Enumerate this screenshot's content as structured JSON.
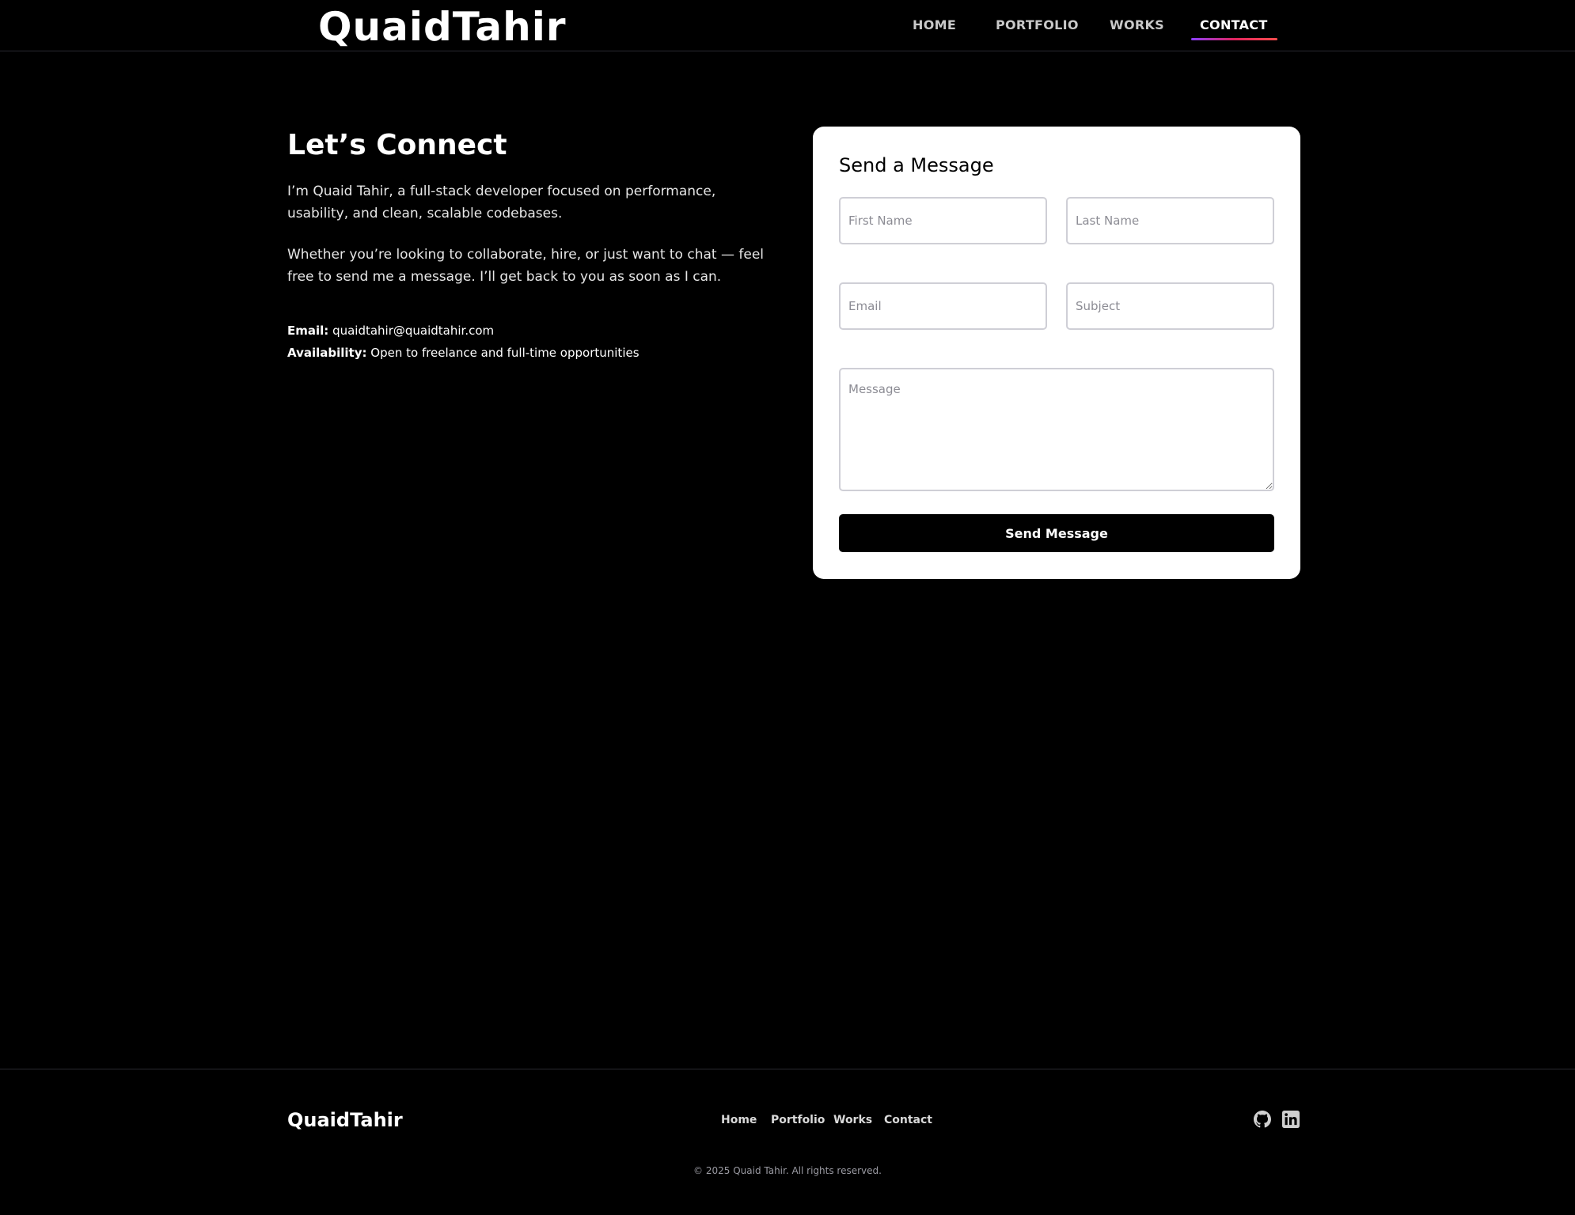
{
  "header": {
    "brand": "QuaidTahir",
    "nav": [
      {
        "label": "HOME"
      },
      {
        "label": "PORTFOLIO"
      },
      {
        "label": "WORKS"
      },
      {
        "label": "CONTACT",
        "active": true
      }
    ]
  },
  "intro": {
    "title": "Let’s Connect",
    "paragraph1": "I’m Quaid Tahir, a full-stack developer focused on performance, usability, and clean, scalable codebases.",
    "paragraph2": "Whether you’re looking to collaborate, hire, or just want to chat — feel free to send me a message. I’ll get back to you as soon as I can.",
    "email_label": "Email:",
    "email_value": "quaidtahir@quaidtahir.com",
    "availability_label": "Availability:",
    "availability_value": "Open to freelance and full-time opportunities"
  },
  "form": {
    "title": "Send a Message",
    "first_name": {
      "placeholder": "First Name",
      "value": ""
    },
    "last_name": {
      "placeholder": "Last Name",
      "value": ""
    },
    "email": {
      "placeholder": "Email",
      "value": ""
    },
    "subject": {
      "placeholder": "Subject",
      "value": ""
    },
    "message": {
      "placeholder": "Message",
      "value": ""
    },
    "submit_label": "Send Message"
  },
  "footer": {
    "brand": "QuaidTahir",
    "nav": [
      {
        "label": "Home"
      },
      {
        "label": "Portfolio"
      },
      {
        "label": "Works"
      },
      {
        "label": "Contact"
      }
    ],
    "social": [
      {
        "icon": "github-icon"
      },
      {
        "icon": "linkedin-icon"
      }
    ],
    "copyright": "© 2025 Quaid Tahir. All rights reserved."
  },
  "colors": {
    "background": "#000000",
    "card": "#ffffff",
    "accent_gradient_start": "#8a3ffc",
    "accent_gradient_end": "#ff4d4d"
  }
}
